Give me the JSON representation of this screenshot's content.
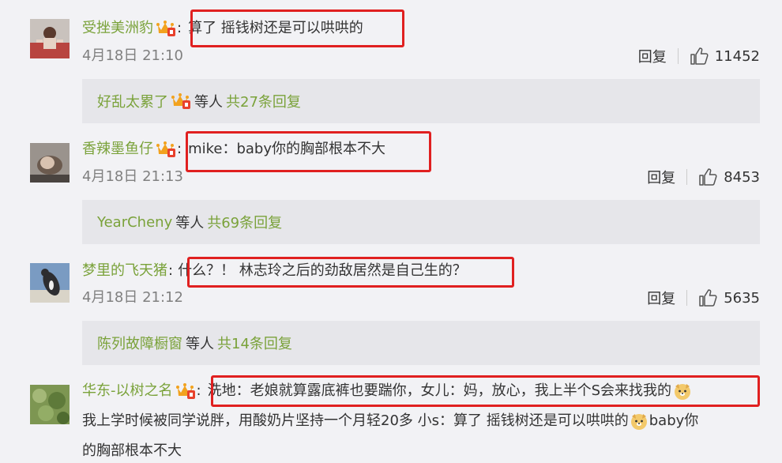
{
  "comments": [
    {
      "username": "受挫美洲豹",
      "text": "算了 摇钱树还是可以哄哄的",
      "time": "4月18日 21:10",
      "reply_label": "回复",
      "likes": "11452",
      "reply_users": "好乱太累了",
      "reply_mid": "等人",
      "reply_count": "共27条回复"
    },
    {
      "username": "香辣墨鱼仔",
      "text": "mike：baby你的胸部根本不大",
      "time": "4月18日 21:13",
      "reply_label": "回复",
      "likes": "8453",
      "reply_users": "YearCheny",
      "reply_mid": "等人",
      "reply_count": "共69条回复"
    },
    {
      "username": "梦里的飞天猪",
      "text": "什么？！ 林志玲之后的劲敌居然是自己生的？",
      "time": "4月18日 21:12",
      "reply_label": "回复",
      "likes": "5635",
      "reply_users": "陈列故障橱窗",
      "reply_mid": "等人",
      "reply_count": "共14条回复"
    },
    {
      "username": "华东-以树之名",
      "text": "洗地：老娘就算露底裤也要踹你，女儿：妈，放心，我上半个S会来找我的",
      "text_line2_a": "我上学时候被同学说胖，用酸奶片坚持一个月轻20多  小s：算了 摇钱树还是可以哄哄的",
      "text_line2_b": "baby你",
      "text_line3": "的胸部根本不大"
    }
  ],
  "colors": {
    "username": "#7aa23a",
    "highlight_box": "#e02020",
    "background": "#f2f2f5",
    "reply_bar": "#e6e6ea"
  },
  "icons": [
    "crown-badge-icon",
    "thumbs-up-icon",
    "dog-emoji-icon"
  ]
}
